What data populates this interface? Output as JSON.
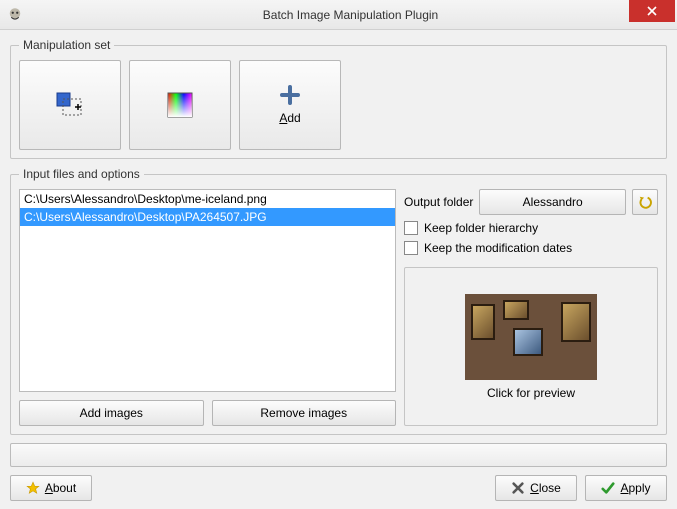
{
  "window": {
    "title": "Batch Image Manipulation Plugin"
  },
  "manipulation": {
    "legend": "Manipulation set",
    "add_label": "Add"
  },
  "files": {
    "legend": "Input files and options",
    "items": [
      {
        "path": "C:\\Users\\Alessandro\\Desktop\\me-iceland.png",
        "selected": false
      },
      {
        "path": "C:\\Users\\Alessandro\\Desktop\\PA264507.JPG",
        "selected": true
      }
    ],
    "add_label": "Add images",
    "remove_label": "Remove images"
  },
  "output": {
    "label": "Output folder",
    "folder_button": "Alessandro",
    "keep_hierarchy": "Keep folder hierarchy",
    "keep_dates": "Keep the modification dates",
    "preview_caption": "Click for preview"
  },
  "buttons": {
    "about": "About",
    "close": "Close",
    "apply": "Apply"
  }
}
